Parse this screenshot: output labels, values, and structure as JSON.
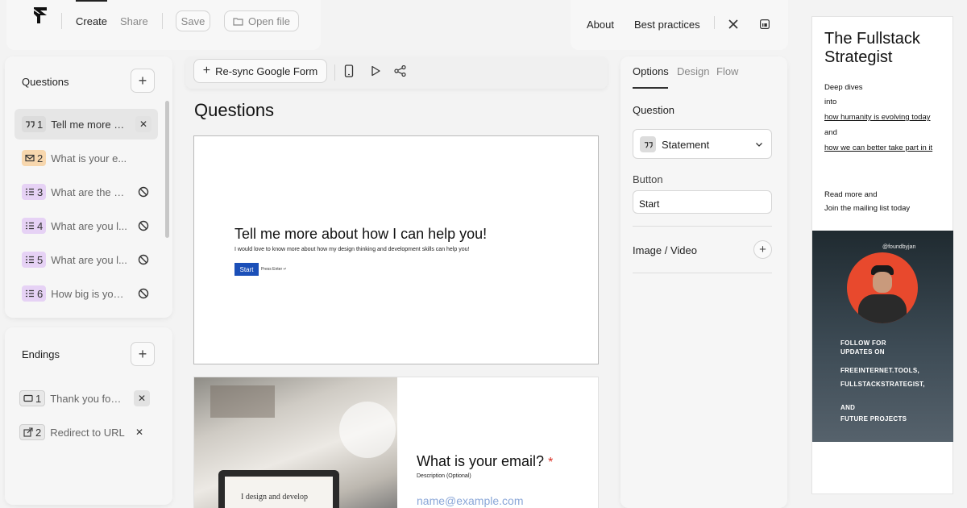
{
  "topbar": {
    "tabs": [
      "Create",
      "Share"
    ],
    "save_label": "Save",
    "open_file_label": "Open file"
  },
  "topnav": {
    "about": "About",
    "best_practices": "Best practices"
  },
  "sidebar": {
    "title": "Questions",
    "items": [
      {
        "num": "1",
        "text": "Tell me more a...",
        "type": "statement"
      },
      {
        "num": "2",
        "text": "What is your e...",
        "type": "email"
      },
      {
        "num": "3",
        "text": "What are the m...",
        "type": "list"
      },
      {
        "num": "4",
        "text": "What are you l...",
        "type": "list"
      },
      {
        "num": "5",
        "text": "What are you l...",
        "type": "list"
      },
      {
        "num": "6",
        "text": "How big is you...",
        "type": "list"
      }
    ]
  },
  "endings": {
    "title": "Endings",
    "items": [
      {
        "num": "1",
        "text": "Thank you for ..."
      },
      {
        "num": "2",
        "text": "Redirect to URL"
      }
    ]
  },
  "toolbar": {
    "resync_label": "Re-sync Google Form"
  },
  "main": {
    "heading": "Questions",
    "card1": {
      "title": "Tell me more about how I can help you!",
      "subtitle": "I would love to know more about how my design thinking and development skills can help you!",
      "button": "Start",
      "hint": "Press Enter ↵"
    },
    "card2": {
      "title": "What is your email?",
      "required_mark": "*",
      "description": "Description (Optional)",
      "placeholder": "name@example.com",
      "laptop_text": "I design and develop"
    }
  },
  "options_panel": {
    "tabs": [
      "Options",
      "Design",
      "Flow"
    ],
    "question_label": "Question",
    "question_type": "Statement",
    "button_label": "Button",
    "button_value": "Start",
    "media_label": "Image / Video"
  },
  "preview": {
    "title": "The Fullstack Strategist",
    "lines": [
      "Deep dives",
      "into",
      "how humanity is evolving today",
      "and",
      "how we can better take part in it"
    ],
    "cta_lines": [
      "Read more and",
      "Join the mailing list today"
    ],
    "handle": "@foundbyjan",
    "banner_lines": [
      "FOLLOW FOR",
      "UPDATES ON",
      "FREEINTERNET.TOOLS,",
      "FULLSTACKSTRATEGIST,",
      "AND",
      "FUTURE PROJECTS"
    ]
  },
  "colors": {
    "accent_blue": "#1b4fb8",
    "required_red": "#d93025",
    "banner_orange": "#e8492d"
  }
}
